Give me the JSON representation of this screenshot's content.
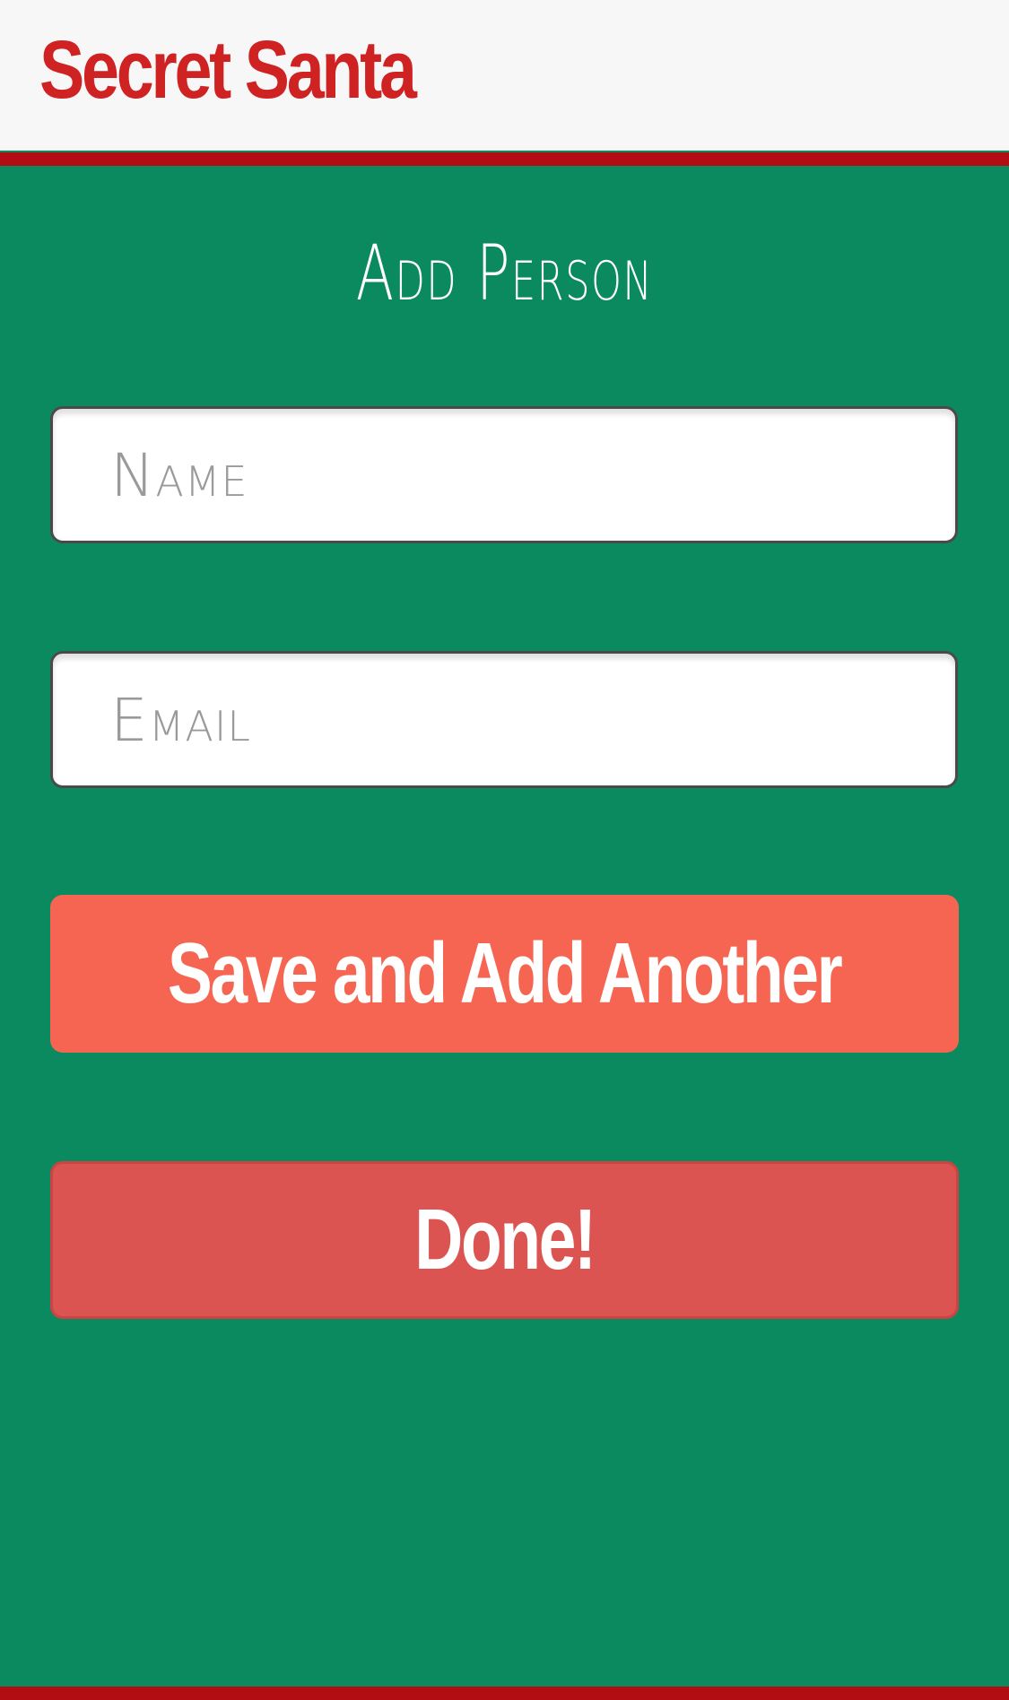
{
  "header": {
    "brand": "Secret Santa"
  },
  "main": {
    "title": "Add Person",
    "name_placeholder": "Name",
    "name_value": "",
    "email_placeholder": "Email",
    "email_value": "",
    "save_button_label": "Save and Add Another",
    "done_button_label": "Done!"
  },
  "colors": {
    "background": "#0c8a5f",
    "header_bg": "#f7f7f7",
    "brand": "#cf2222",
    "stripe": "#b10d12",
    "save_button": "#f66551",
    "done_button": "#dc5452"
  }
}
